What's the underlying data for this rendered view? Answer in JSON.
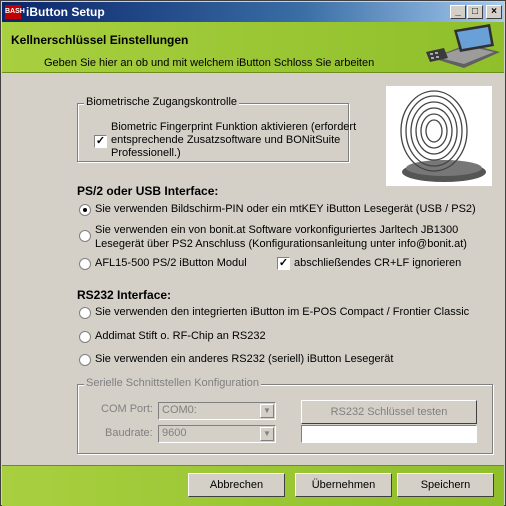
{
  "window": {
    "title": "iButton Setup",
    "app_icon_text": "BASH",
    "minimize": "_",
    "maximize": "□",
    "close": "×"
  },
  "header": {
    "title": "Kellnerschlüssel Einstellungen",
    "subtitle": "Geben Sie hier an ob und mit welchem iButton Schloss Sie arbeiten"
  },
  "biometric": {
    "legend": "Biometrische Zugangskontrolle",
    "checkbox_label_line1": "Biometric Fingerprint Funktion aktivieren (erfordert",
    "checkbox_label_line2": "entsprechende Zusatzsoftware und BONitSuite",
    "checkbox_label_line3": "Professionell.)",
    "checked": true
  },
  "ps2": {
    "heading": "PS/2 oder USB Interface:",
    "opt1": "Sie verwenden Bildschirm-PIN oder ein mtKEY iButton Lesegerät (USB / PS2)",
    "opt2_line1": "Sie verwenden ein von bonit.at Software vorkonfiguriertes  Jarltech JB1300",
    "opt2_line2": "Lesegerät über PS2 Anschluss (Konfigurationsanleitung unter info@bonit.at)",
    "opt3": "AFL15-500 PS/2 iButton Modul",
    "crlf_label": "abschließendes CR+LF ignorieren",
    "crlf_checked": true,
    "selected": 1
  },
  "rs232": {
    "heading": "RS232 Interface:",
    "opt1": "Sie verwenden den integrierten iButton im E-POS Compact / Frontier Classic",
    "opt2": "Addimat Stift o. RF-Chip an RS232",
    "opt3": "Sie verwenden ein anderes RS232 (seriell) iButton Lesegerät"
  },
  "serial": {
    "legend": "Serielle Schnittstellen Konfiguration",
    "com_label": "COM Port:",
    "com_value": "COM0:",
    "baud_label": "Baudrate:",
    "baud_value": "9600",
    "test_button": "RS232 Schlüssel testen",
    "test_value": ""
  },
  "footer": {
    "cancel": "Abbrechen",
    "apply": "Übernehmen",
    "save": "Speichern"
  }
}
